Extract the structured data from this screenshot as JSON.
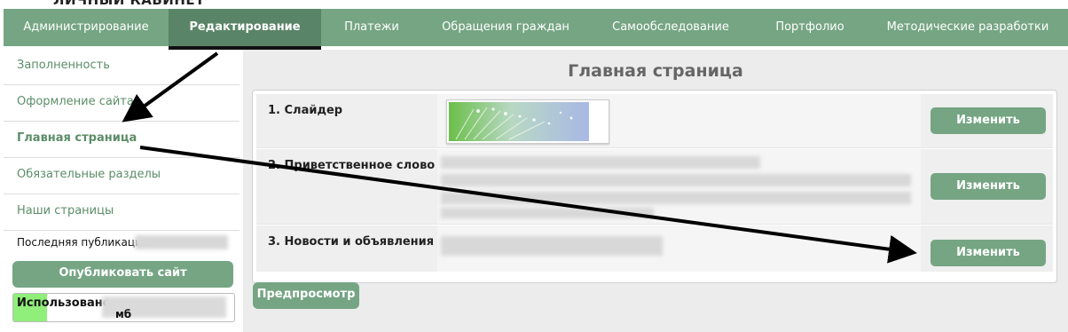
{
  "header": {
    "title": "ЛИЧНЫЙ КАБИНЕТ"
  },
  "topnav": {
    "items": [
      {
        "label": "Администрирование"
      },
      {
        "label": "Редактирование",
        "active": true
      },
      {
        "label": "Платежи"
      },
      {
        "label": "Обращения граждан"
      },
      {
        "label": "Самообследование"
      },
      {
        "label": "Портфолио"
      },
      {
        "label": "Методические разработки"
      }
    ]
  },
  "sidebar": {
    "items": [
      {
        "label": "Заполненность"
      },
      {
        "label": "Оформление сайта"
      },
      {
        "label": "Главная страница",
        "active": true
      },
      {
        "label": "Обязательные разделы"
      },
      {
        "label": "Наши страницы"
      }
    ],
    "last_publication_label": "Последняя публикация:",
    "publish_button": "Опубликовать сайт",
    "usage_label": "Использовано",
    "usage_unit": "мб"
  },
  "main": {
    "title": "Главная страница",
    "rows": [
      {
        "label": "1. Слайдер",
        "button": "Изменить"
      },
      {
        "label": "2. Приветственное слово",
        "button": "Изменить"
      },
      {
        "label": "3. Новости и объявления",
        "button": "Изменить"
      }
    ],
    "preview_button": "Предпросмотр"
  },
  "colors": {
    "accent": "#75a583",
    "accent_active": "#5a8467",
    "link": "#5b8d68",
    "annotation_arrow": "#000000",
    "usage_bar": "#90ee7a"
  }
}
